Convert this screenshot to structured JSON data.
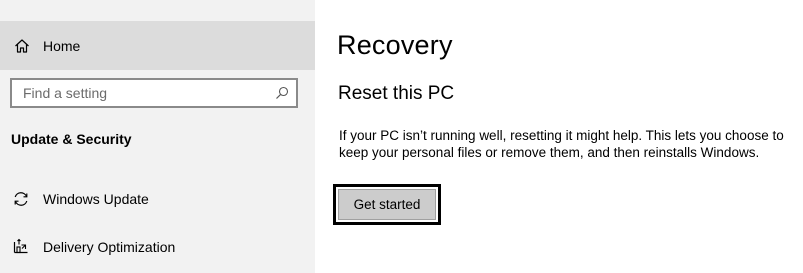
{
  "sidebar": {
    "home": {
      "label": "Home",
      "icon": "home-icon"
    },
    "search": {
      "placeholder": "Find a setting",
      "value": "",
      "icon": "search-icon"
    },
    "section_title": "Update & Security",
    "items": [
      {
        "label": "Windows Update",
        "icon": "sync-icon"
      },
      {
        "label": "Delivery Optimization",
        "icon": "delivery-optimization-icon"
      }
    ]
  },
  "main": {
    "title": "Recovery",
    "reset": {
      "heading": "Reset this PC",
      "description": "If your PC isn’t running well, resetting it might help. This lets you choose to keep your personal files or remove them, and then reinstalls Windows.",
      "button_label": "Get started"
    }
  },
  "colors": {
    "sidebar_bg": "#f2f2f2",
    "selected_bg": "#dcdcdc",
    "button_bg": "#cccccc",
    "highlight_border": "#000000"
  }
}
